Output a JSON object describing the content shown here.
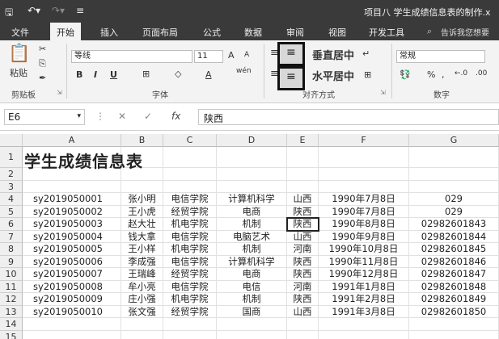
{
  "titlebar": {
    "save_icon": "save-icon",
    "undo_icon": "undo-icon",
    "redo_icon": "redo-icon",
    "doc_title": "项目八 学生成绩信息表的制作.x"
  },
  "tabs": [
    "文件",
    "开始",
    "插入",
    "页面布局",
    "公式",
    "数据",
    "审阅",
    "视图",
    "开发工具"
  ],
  "tell_me": "告诉我您想要",
  "ribbon": {
    "paste": "粘贴",
    "clipboard_group": "剪贴板",
    "font_name": "等线",
    "font_size": "11",
    "font_group": "字体",
    "bold": "B",
    "italic": "I",
    "underline": "U",
    "grow": "A",
    "shrink": "A",
    "wen": "wén",
    "align_group": "对齐方式",
    "vcenter": "垂直居中",
    "hcenter": "水平居中",
    "number_format": "常规",
    "number_group": "数字",
    "percent": "%"
  },
  "formula_bar": {
    "name_box": "E6",
    "fx": "fx",
    "value": "陕西"
  },
  "sheet": {
    "columns": [
      "A",
      "B",
      "C",
      "D",
      "E",
      "F",
      "G"
    ],
    "title": "学生成绩信息表",
    "rows": [
      [
        "sy2019050001",
        "张小明",
        "电信学院",
        "计算机科学",
        "山西",
        "1990年7月8日",
        "029"
      ],
      [
        "sy2019050002",
        "王小虎",
        "经贸学院",
        "电商",
        "陕西",
        "1990年7月8日",
        "029"
      ],
      [
        "sy2019050003",
        "赵大壮",
        "机电学院",
        "机制",
        "陕西",
        "1990年8月8日",
        "02982601843"
      ],
      [
        "sy2019050004",
        "钱大拿",
        "电信学院",
        "电脑艺术",
        "山西",
        "1990年9月8日",
        "02982601844"
      ],
      [
        "sy2019050005",
        "王小样",
        "机电学院",
        "机制",
        "河南",
        "1990年10月8日",
        "02982601845"
      ],
      [
        "sy2019050006",
        "李成强",
        "电信学院",
        "计算机科学",
        "陕西",
        "1990年11月8日",
        "02982601846"
      ],
      [
        "sy2019050007",
        "王瑞峰",
        "经贸学院",
        "电商",
        "陕西",
        "1990年12月8日",
        "02982601847"
      ],
      [
        "sy2019050008",
        "牟小亮",
        "电信学院",
        "电信",
        "河南",
        "1991年1月8日",
        "02982601848"
      ],
      [
        "sy2019050009",
        "庄小强",
        "机电学院",
        "机制",
        "陕西",
        "1991年2月8日",
        "02982601849"
      ],
      [
        "sy2019050010",
        "张文强",
        "经贸学院",
        "国商",
        "山西",
        "1991年3月8日",
        "02982601850"
      ]
    ],
    "row_numbers": [
      "1",
      "2",
      "3",
      "4",
      "5",
      "6",
      "7",
      "8",
      "9",
      "10",
      "11",
      "12",
      "13",
      "14",
      "15"
    ]
  }
}
